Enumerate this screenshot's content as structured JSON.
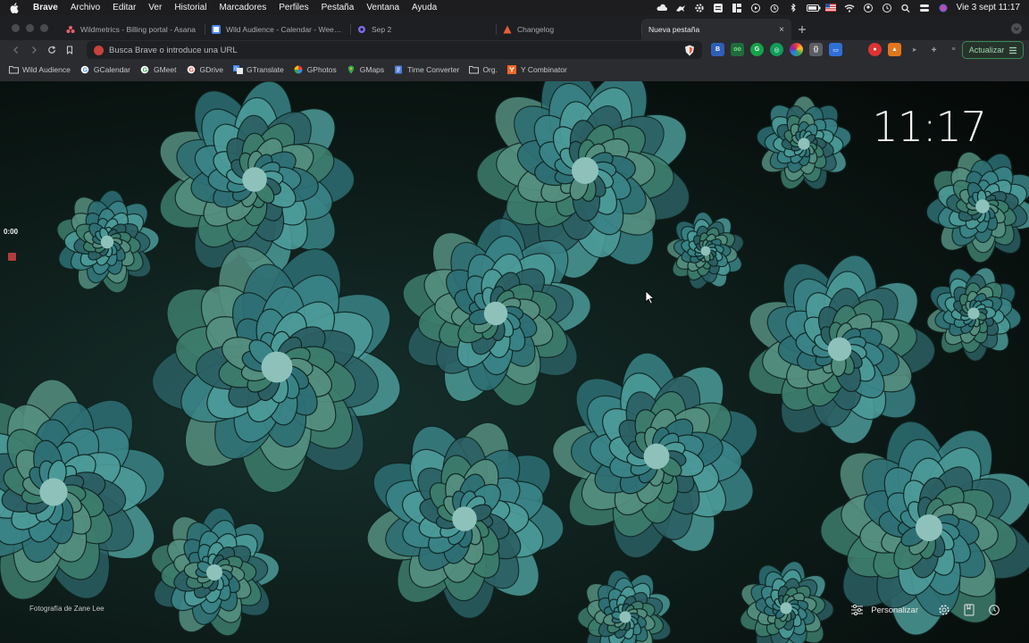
{
  "menubar": {
    "app": "Brave",
    "items": [
      "Archivo",
      "Editar",
      "Ver",
      "Historial",
      "Marcadores",
      "Perfiles",
      "Pestaña",
      "Ventana",
      "Ayuda"
    ],
    "clock": "Vie 3 sept  11:17"
  },
  "tabs": [
    {
      "title": "Wildmetrics - Billing portal - Asana",
      "favicon_color": "#e8606b"
    },
    {
      "title": "Wild Audience - Calendar - Week of",
      "favicon_color": "#4a86e8"
    },
    {
      "title": "Sep 2",
      "favicon_color": "#7b6cf0"
    },
    {
      "title": "Changelog",
      "favicon_color": "#e65c3c"
    },
    {
      "title": "Nueva pestaña",
      "favicon_color": "",
      "close": "×"
    }
  ],
  "toolbar": {
    "omnibox_placeholder": "Busca Brave o introduce una URL",
    "update_label": "Actualizar"
  },
  "bookmarks": [
    {
      "label": "Wild Audience",
      "icon": "folder-icon"
    },
    {
      "label": "GCalendar",
      "icon": "google-icon"
    },
    {
      "label": "GMeet",
      "icon": "google-icon"
    },
    {
      "label": "GDrive",
      "icon": "google-icon"
    },
    {
      "label": "GTranslate",
      "icon": "translate-icon"
    },
    {
      "label": "GPhotos",
      "icon": "photos-icon"
    },
    {
      "label": "GMaps",
      "icon": "maps-icon"
    },
    {
      "label": "Time Converter",
      "icon": "time-icon"
    },
    {
      "label": "Org.",
      "icon": "folder-icon"
    },
    {
      "label": "Y Combinator",
      "icon": "ycombinator-icon"
    }
  ],
  "ntp": {
    "clock": "11:17",
    "timer": "0:00",
    "photo_credit": "Fotografía de Zane Lee",
    "customize_label": "Personalizar"
  },
  "colors": {
    "accent_green": "#3b8a56",
    "brave_orange": "#fb542b"
  }
}
